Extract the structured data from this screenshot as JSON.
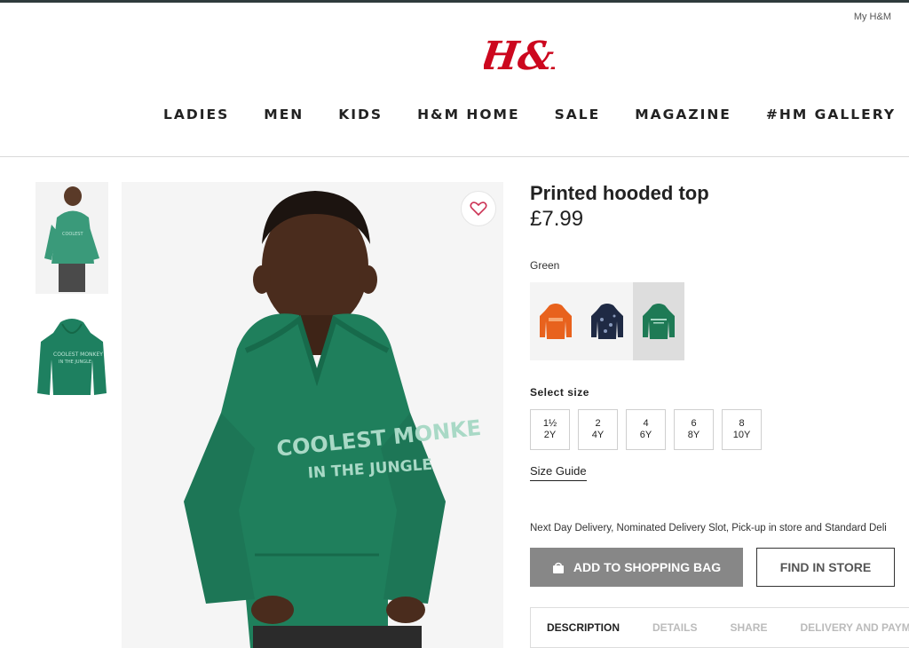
{
  "header": {
    "account_link": "My H&M",
    "brand": "H&M",
    "brand_color": "#cc071e",
    "nav": [
      "LADIES",
      "MEN",
      "KIDS",
      "H&M HOME",
      "SALE",
      "MAGAZINE",
      "#HM GALLERY"
    ]
  },
  "gallery": {
    "main_image": "child-in-green-hoodie",
    "hoodie_print_line1": "COOLEST MONKE",
    "hoodie_print_line2": "IN THE JUNGLE",
    "thumbnails": [
      "model-thumbnail",
      "hoodie-flat-thumbnail"
    ],
    "favorite_icon": "heart-icon"
  },
  "product": {
    "name": "Printed hooded top",
    "price": "£7.99",
    "color": "Green",
    "swatches": [
      {
        "name": "orange",
        "color": "#e8621d"
      },
      {
        "name": "navy",
        "color": "#1f2a44"
      },
      {
        "name": "green",
        "color": "#1e7a55",
        "selected": true
      }
    ],
    "size_title": "Select size",
    "sizes": [
      {
        "top": "1½",
        "bottom": "2Y"
      },
      {
        "top": "2",
        "bottom": "4Y"
      },
      {
        "top": "4",
        "bottom": "6Y"
      },
      {
        "top": "6",
        "bottom": "8Y"
      },
      {
        "top": "8",
        "bottom": "10Y"
      }
    ],
    "size_guide": "Size Guide",
    "delivery": "Next Day Delivery, Nominated Delivery Slot, Pick-up in store and Standard Deli",
    "add_to_bag": "ADD TO SHOPPING BAG",
    "bag_icon": "shopping-bag-icon",
    "find_in_store": "FIND IN STORE",
    "tabs": [
      "DESCRIPTION",
      "DETAILS",
      "SHARE",
      "DELIVERY AND PAYM"
    ],
    "active_tab": "DESCRIPTION"
  }
}
